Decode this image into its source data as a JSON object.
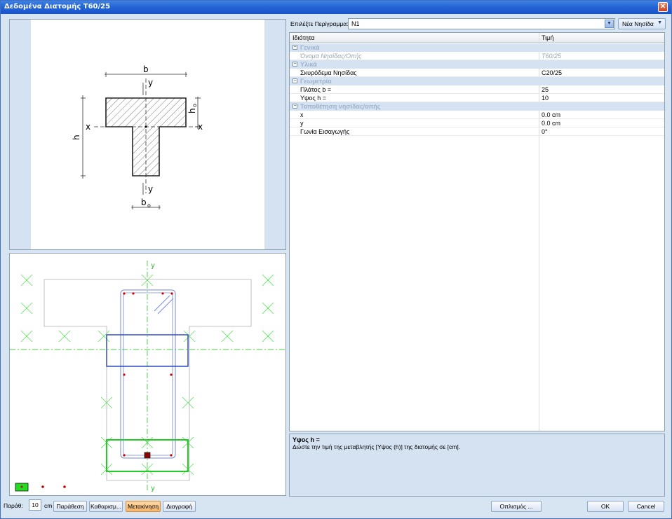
{
  "window": {
    "title": "Δεδομένα Διατομής T60/25"
  },
  "section_drawing": {
    "labels": {
      "b": "b",
      "h": "h",
      "ho": "h",
      "ho_sub": "o",
      "bo": "b",
      "bo_sub": "o",
      "x_left": "x",
      "x_right": "x",
      "y_top": "y",
      "y_bottom": "y"
    }
  },
  "reinforcement_drawing": {
    "y_top": "y",
    "y_bottom": "y"
  },
  "outline_selector": {
    "label": "Επιλέξτε Περίγραμμα:",
    "value": "N1",
    "new_island_label": "Νέα Νησίδα"
  },
  "property_grid": {
    "col_property": "Ιδιότητα",
    "col_value": "Τιμή",
    "sections": [
      {
        "name": "Γενικά",
        "rows": [
          {
            "name": "Όνομα Νησίδας/Οπής",
            "value": "T60/25",
            "disabled": true
          }
        ]
      },
      {
        "name": "Υλικά",
        "rows": [
          {
            "name": "Σκυρόδεμα Νησίδας",
            "value": "C20/25"
          }
        ]
      },
      {
        "name": "Γεωμετρία",
        "rows": [
          {
            "name": "Πλάτος b =",
            "value": "25"
          },
          {
            "name": "Υψος h =",
            "value": "10"
          }
        ]
      },
      {
        "name": "Τοποθέτηση νησίδας/οπής",
        "rows": [
          {
            "name": "x",
            "value": "0.0 cm"
          },
          {
            "name": "y",
            "value": "0.0 cm"
          },
          {
            "name": "Γωνία Εισαγωγής",
            "value": "0°"
          }
        ]
      }
    ]
  },
  "help": {
    "title": "Υψος h =",
    "text": "Δώστε την τιμή της μεταβλητής [Υψος (h)] της διατομής σε [cm]."
  },
  "toolbar": {
    "step_label": "Παράθ:",
    "step_value": "10",
    "step_unit": "cm",
    "buttons": [
      "Παράθεση",
      "Καθαρισμ...",
      "Μετακίνηση",
      "Διαγραφή"
    ],
    "options_label": "Οπλισμός ...",
    "ok_label": "OK",
    "cancel_label": "Cancel"
  },
  "colors": {
    "title_bar": "#2566d6",
    "active_button": "#f6b46a",
    "axis_green": "#22cc22",
    "stirrup_blue": "#2040c0",
    "bar_red": "#cc0000"
  }
}
